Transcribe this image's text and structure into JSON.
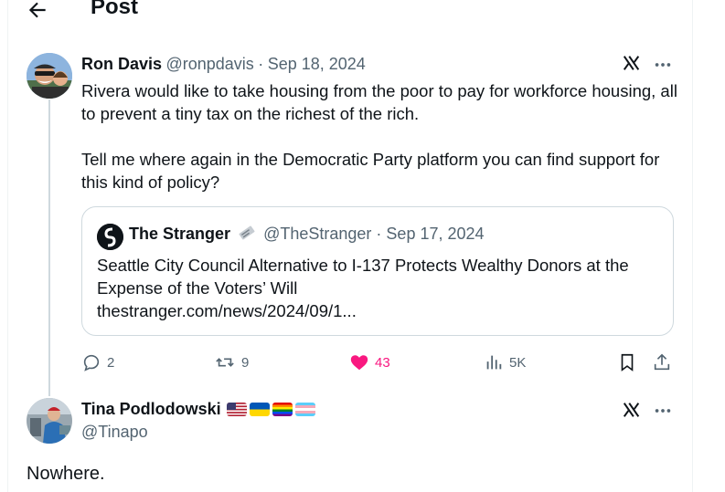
{
  "header": {
    "title": "Post"
  },
  "tweet": {
    "author_name": "Ron Davis",
    "author_handle": "@ronpdavis",
    "separator": "·",
    "date": "Sep 18, 2024",
    "paragraphs": [
      "Rivera would like to take housing from the poor to pay for workforce housing, all to prevent a tiny tax on the richest of the rich.",
      "Tell me where again in the Democratic Party platform you can find support for this kind of policy?"
    ],
    "quote": {
      "author_name": "The Stranger",
      "author_handle": "@TheStranger",
      "separator": "·",
      "date": "Sep 17, 2024",
      "text": "Seattle City Council Alternative to I-137 Protects Wealthy Donors at the Expense of the Voters’ Will",
      "link": "thestranger.com/news/2024/09/1..."
    },
    "actions": {
      "replies": "2",
      "reposts": "9",
      "likes": "43",
      "views": "5K"
    },
    "like_color": "#f91880"
  },
  "reply": {
    "author_name": "Tina Podlodowski",
    "author_handle": "@Tinapo",
    "flags": [
      "us-flag",
      "ukraine-flag",
      "rainbow-flag",
      "transgender-flag"
    ],
    "text": "Nowhere."
  }
}
